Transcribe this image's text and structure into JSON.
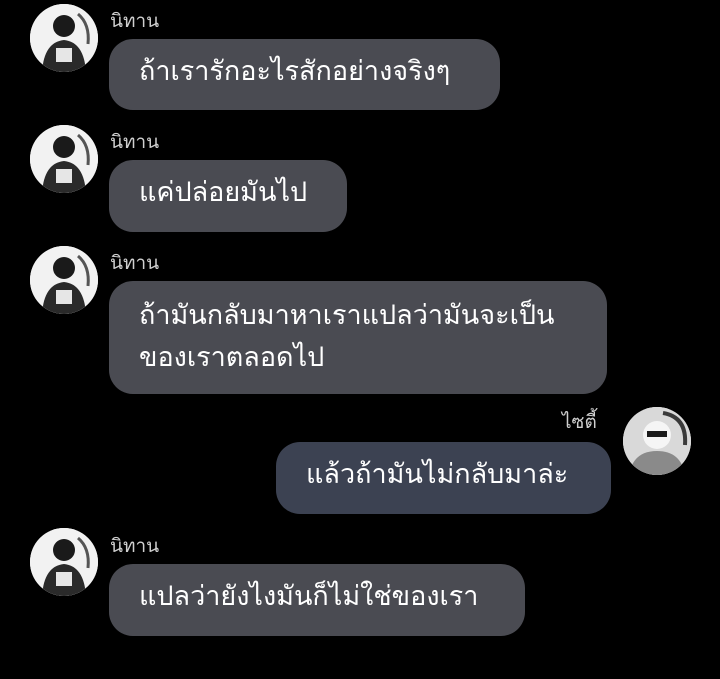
{
  "colors": {
    "background": "#000000",
    "incoming_bubble": "#4a4b52",
    "outgoing_bubble": "#3c4252",
    "sender_name": "#cfcfcf",
    "message_text": "#ffffff"
  },
  "messages": [
    {
      "direction": "incoming",
      "sender": "นิทาน",
      "avatar_icon": "user-avatar-photo-icon",
      "lines": [
        "ถ้าเรารักอะไรสักอย่างจริงๆ"
      ]
    },
    {
      "direction": "incoming",
      "sender": "นิทาน",
      "avatar_icon": "user-avatar-photo-icon",
      "lines": [
        "แค่ปล่อยมันไป"
      ]
    },
    {
      "direction": "incoming",
      "sender": "นิทาน",
      "avatar_icon": "user-avatar-photo-icon",
      "lines": [
        "ถ้ามันกลับมาหาเราแปลว่ามันจะเป็น",
        "ของเราตลอดไป"
      ]
    },
    {
      "direction": "outgoing",
      "sender": "ไซตี้",
      "avatar_icon": "user-avatar-photo-icon",
      "lines": [
        "แล้วถ้ามันไม่กลับมาล่ะ"
      ]
    },
    {
      "direction": "incoming",
      "sender": "นิทาน",
      "avatar_icon": "user-avatar-photo-icon",
      "lines": [
        "แปลว่ายังไงมันก็ไม่ใช่ของเรา"
      ]
    }
  ]
}
